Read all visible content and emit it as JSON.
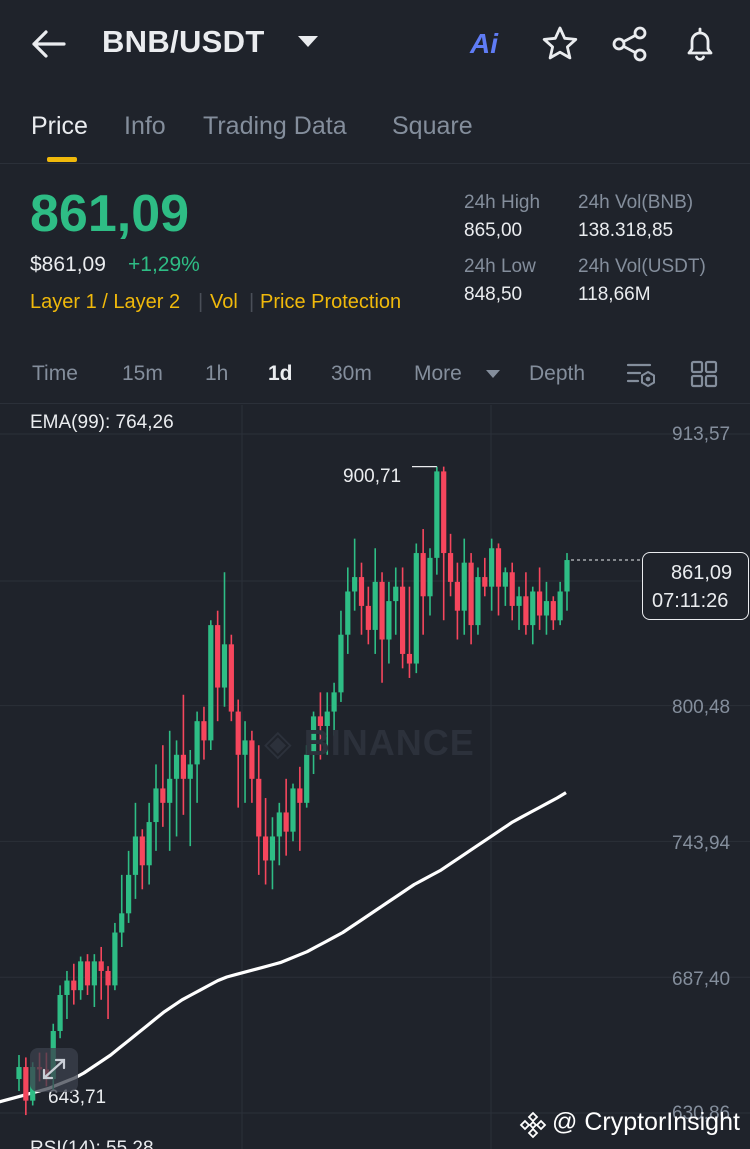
{
  "header": {
    "pair": "BNB/USDT",
    "icons": [
      "back-arrow-icon",
      "dropdown-caret-icon",
      "ai-icon",
      "star-icon",
      "share-icon",
      "bell-icon"
    ],
    "ai_label": "Ai"
  },
  "tabs": [
    "Price",
    "Info",
    "Trading Data",
    "Square"
  ],
  "active_tab": "Price",
  "price": {
    "last": "861,09",
    "usd": "$861,09",
    "change": "+1,29%",
    "tags": [
      "Layer 1 / Layer 2",
      "Vol",
      "Price Protection"
    ]
  },
  "stats": {
    "high_label": "24h High",
    "high_value": "865,00",
    "low_label": "24h Low",
    "low_value": "848,50",
    "vol_bnb_label": "24h Vol(BNB)",
    "vol_bnb_value": "138.318,85",
    "vol_usdt_label": "24h Vol(USDT)",
    "vol_usdt_value": "118,66M"
  },
  "toolbar": {
    "items": [
      "Time",
      "15m",
      "1h",
      "1d",
      "30m",
      "More",
      "Depth"
    ],
    "active": "1d",
    "icons": [
      "indicator-settings-icon",
      "grid-layout-icon"
    ]
  },
  "chart": {
    "ema_label": "EMA(99): 764,26",
    "y_labels": [
      "913,57",
      "800,48",
      "743,94",
      "687,40",
      "630,86"
    ],
    "high_marker": "900,71",
    "low_marker": "643,71",
    "current_price": "861,09",
    "countdown": "07:11:26",
    "watermark": "BINANCE",
    "rsi_label": "RSI(14): 55,28",
    "colors": {
      "up": "#2ebd85",
      "down": "#f6465d",
      "ema": "#ffffff"
    }
  },
  "credit": "@ CryptorInsight",
  "chart_data": {
    "type": "candlestick",
    "interval": "1d",
    "ylim": [
      630.86,
      913.57
    ],
    "y_ticks": [
      913.57,
      800.48,
      743.94,
      687.4,
      630.86
    ],
    "series": [
      {
        "name": "candles",
        "ohlc": [
          [
            645,
            655,
            640,
            650
          ],
          [
            650,
            654,
            630,
            636
          ],
          [
            636,
            652,
            634,
            650
          ],
          [
            650,
            656,
            644,
            649
          ],
          [
            649,
            656,
            642,
            645
          ],
          [
            645,
            668,
            640,
            665
          ],
          [
            665,
            684,
            662,
            680
          ],
          [
            680,
            690,
            670,
            686
          ],
          [
            686,
            693,
            676,
            682
          ],
          [
            682,
            696,
            678,
            694
          ],
          [
            694,
            697,
            680,
            684
          ],
          [
            684,
            697,
            675,
            694
          ],
          [
            694,
            700,
            678,
            690
          ],
          [
            690,
            692,
            670,
            684
          ],
          [
            684,
            710,
            682,
            706
          ],
          [
            706,
            730,
            700,
            714
          ],
          [
            714,
            740,
            710,
            730
          ],
          [
            730,
            760,
            720,
            746
          ],
          [
            746,
            749,
            724,
            734
          ],
          [
            734,
            760,
            726,
            752
          ],
          [
            752,
            776,
            740,
            766
          ],
          [
            766,
            784,
            750,
            760
          ],
          [
            760,
            790,
            740,
            770
          ],
          [
            770,
            786,
            746,
            780
          ],
          [
            780,
            805,
            755,
            770
          ],
          [
            770,
            782,
            742,
            776
          ],
          [
            776,
            798,
            760,
            794
          ],
          [
            794,
            800,
            778,
            786
          ],
          [
            786,
            836,
            782,
            834
          ],
          [
            834,
            840,
            794,
            808
          ],
          [
            808,
            856,
            800,
            826
          ],
          [
            826,
            830,
            794,
            798
          ],
          [
            798,
            803,
            758,
            780
          ],
          [
            780,
            794,
            760,
            786
          ],
          [
            786,
            790,
            760,
            770
          ],
          [
            770,
            784,
            730,
            746
          ],
          [
            746,
            762,
            726,
            736
          ],
          [
            736,
            754,
            724,
            746
          ],
          [
            746,
            760,
            734,
            756
          ],
          [
            756,
            770,
            738,
            748
          ],
          [
            748,
            768,
            744,
            766
          ],
          [
            766,
            775,
            740,
            760
          ],
          [
            760,
            784,
            758,
            780
          ],
          [
            780,
            798,
            772,
            796
          ],
          [
            796,
            806,
            778,
            792
          ],
          [
            792,
            806,
            780,
            798
          ],
          [
            798,
            810,
            788,
            806
          ],
          [
            806,
            840,
            802,
            830
          ],
          [
            830,
            858,
            822,
            848
          ],
          [
            848,
            870,
            840,
            854
          ],
          [
            854,
            860,
            830,
            842
          ],
          [
            842,
            850,
            826,
            832
          ],
          [
            832,
            866,
            822,
            852
          ],
          [
            852,
            856,
            810,
            828
          ],
          [
            828,
            852,
            818,
            844
          ],
          [
            844,
            858,
            830,
            850
          ],
          [
            850,
            858,
            816,
            822
          ],
          [
            822,
            850,
            812,
            818
          ],
          [
            818,
            868,
            814,
            864
          ],
          [
            864,
            874,
            830,
            846
          ],
          [
            846,
            866,
            838,
            862
          ],
          [
            862,
            900,
            855,
            898
          ],
          [
            898,
            900,
            836,
            864
          ],
          [
            864,
            872,
            846,
            852
          ],
          [
            852,
            860,
            828,
            840
          ],
          [
            840,
            870,
            830,
            860
          ],
          [
            860,
            864,
            826,
            834
          ],
          [
            834,
            858,
            830,
            854
          ],
          [
            854,
            862,
            846,
            850
          ],
          [
            850,
            870,
            840,
            866
          ],
          [
            866,
            868,
            838,
            850
          ],
          [
            850,
            858,
            842,
            856
          ],
          [
            856,
            860,
            836,
            842
          ],
          [
            842,
            850,
            832,
            846
          ],
          [
            846,
            856,
            830,
            834
          ],
          [
            834,
            850,
            826,
            848
          ],
          [
            848,
            858,
            832,
            838
          ],
          [
            838,
            852,
            830,
            844
          ],
          [
            844,
            846,
            832,
            836
          ],
          [
            836,
            852,
            834,
            848
          ],
          [
            848,
            864,
            840,
            861.09
          ]
        ]
      },
      {
        "name": "EMA(99)",
        "values": [
          631,
          632,
          632.5,
          633,
          634,
          635,
          636,
          637,
          638,
          639,
          640,
          641,
          642.5,
          644,
          645.5,
          647.5,
          650,
          652.5,
          655,
          658,
          661,
          664,
          667,
          670,
          673,
          675.5,
          678,
          680,
          682,
          684,
          686,
          687.5,
          688.5,
          689.5,
          690.5,
          691.5,
          692.5,
          693.5,
          695,
          696.5,
          698,
          700,
          702,
          704,
          706,
          708.5,
          711,
          713.5,
          716,
          718.5,
          721,
          723.5,
          726,
          728,
          730,
          732,
          734.5,
          737,
          739.5,
          742,
          744.5,
          747,
          749.5,
          752,
          754,
          756,
          758,
          760,
          762,
          764.26
        ]
      }
    ]
  }
}
